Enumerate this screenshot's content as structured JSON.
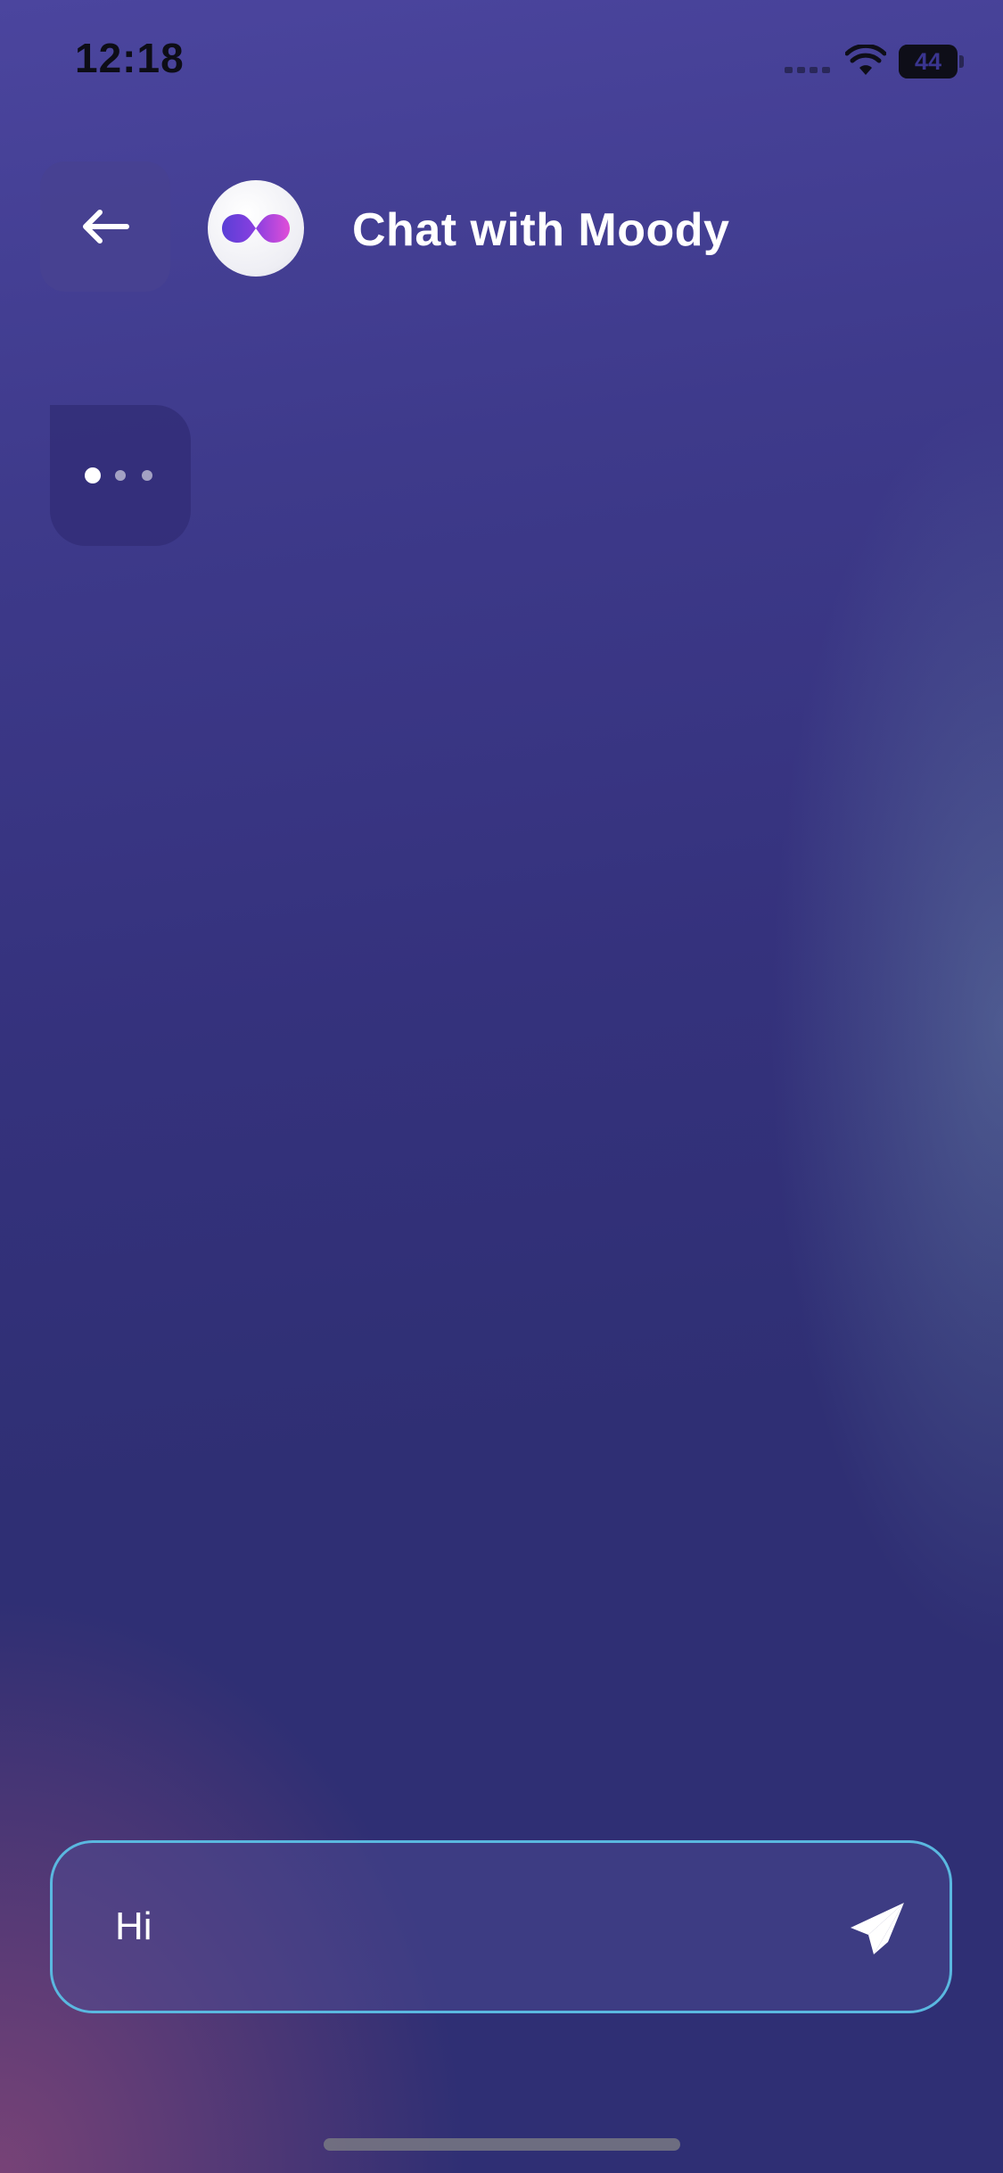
{
  "status_bar": {
    "time": "12:18",
    "battery_level": "44",
    "battery_percent": 44,
    "icons": [
      "cellular-signal-icon",
      "wifi-icon",
      "battery-icon"
    ]
  },
  "header": {
    "back_icon": "arrow-left-icon",
    "avatar_icon": "infinity-logo-icon",
    "title": "Chat with Moody"
  },
  "chat": {
    "typing_indicator": {
      "state": "typing",
      "dot_count": 3
    }
  },
  "composer": {
    "input_value": "Hi",
    "send_icon": "paper-plane-icon"
  },
  "colors": {
    "background_top": "#4b459e",
    "background_bottom": "#2f2f74",
    "input_border": "#5ab8e0",
    "title_text": "#ffffff"
  }
}
